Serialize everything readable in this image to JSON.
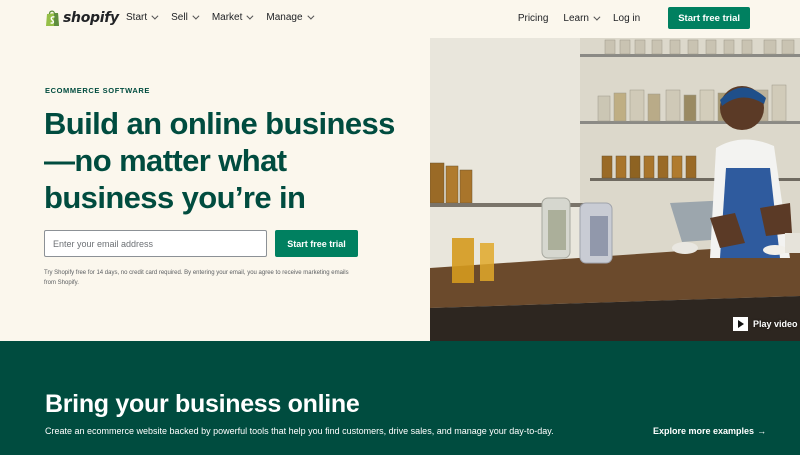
{
  "nav": {
    "logo_text": "shopify",
    "menu": [
      {
        "label": "Start"
      },
      {
        "label": "Sell"
      },
      {
        "label": "Market"
      },
      {
        "label": "Manage"
      }
    ],
    "pricing": "Pricing",
    "learn": "Learn",
    "login": "Log in",
    "cta": "Start free trial"
  },
  "hero": {
    "eyebrow": "ECOMMERCE SOFTWARE",
    "headline": "Build an online business—no matter what business you’re in",
    "email_placeholder": "Enter your email address",
    "cta": "Start free trial",
    "disclaimer": "Try Shopify free for 14 days, no credit card required. By entering your email, you agree to receive marketing emails from Shopify.",
    "play_label": "Play video"
  },
  "band": {
    "title": "Bring your business online",
    "subtitle": "Create an ecommerce website backed by powerful tools that help you find customers, drive sales, and manage your day-to-day.",
    "link": "Explore more examples",
    "link_arrow": "→"
  },
  "colors": {
    "brand_green": "#008060",
    "dark_green": "#004c3f",
    "cream": "#fbf7ed"
  }
}
